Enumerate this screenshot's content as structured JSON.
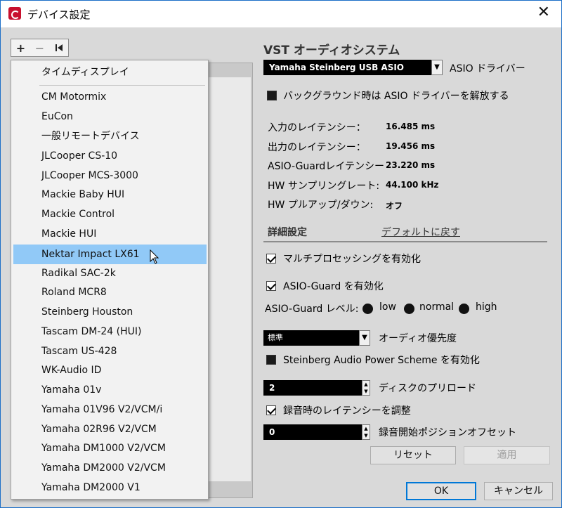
{
  "window": {
    "title": "デバイス設定",
    "close_glyph": "✕"
  },
  "toolbar": {
    "add_glyph": "+",
    "remove_glyph": "−",
    "reset_glyph": "⏮"
  },
  "menu": {
    "header": "タイムディスプレイ",
    "items": [
      "CM Motormix",
      "EuCon",
      "一般リモートデバイス",
      "JLCooper CS-10",
      "JLCooper MCS-3000",
      "Mackie Baby HUI",
      "Mackie Control",
      "Mackie HUI",
      "Nektar Impact LX61",
      "Radikal SAC-2k",
      "Roland MCR8",
      "Steinberg Houston",
      "Tascam DM-24 (HUI)",
      "Tascam US-428",
      "WK-Audio ID",
      "Yamaha 01v",
      "Yamaha 01V96 V2/VCM/i",
      "Yamaha 02R96 V2/VCM",
      "Yamaha DM1000 V2/VCM",
      "Yamaha DM2000 V2/VCM",
      "Yamaha DM2000 V1"
    ],
    "highlighted_index": 8
  },
  "vst": {
    "title": "VST オーディオシステム",
    "driver_value": "Yamaha Steinberg USB ASIO",
    "driver_label": "ASIO ドライバー",
    "release_driver_label": "バックグラウンド時は ASIO ドライバーを解放する",
    "release_driver_checked": false,
    "info": [
      {
        "label": "入力のレイテンシー：",
        "value": "16.485 ms"
      },
      {
        "label": "出力のレイテンシー：",
        "value": "19.456 ms"
      },
      {
        "label": "ASIO-Guardレイテンシー",
        "value": "23.220 ms"
      },
      {
        "label": "HW サンプリングレート:",
        "value": "44.100 kHz"
      },
      {
        "label": "HW プルアップ/ダウン:",
        "value": "オフ"
      }
    ],
    "advanced_title": "詳細設定",
    "reset_defaults": "デフォルトに戻す",
    "multiprocessing_label": "マルチプロセッシングを有効化",
    "multiprocessing_checked": true,
    "asio_guard_label": "ASIO-Guard を有効化",
    "asio_guard_checked": true,
    "asio_guard_level_label": "ASIO-Guard レベル:",
    "level_low": "low",
    "level_normal": "normal",
    "level_high": "high",
    "audio_priority_value": "標準",
    "audio_priority_label": "オーディオ優先度",
    "power_scheme_label": "Steinberg Audio Power Scheme を有効化",
    "power_scheme_checked": false,
    "disk_preload_value": "2",
    "disk_preload_label": "ディスクのプリロード",
    "adjust_latency_label": "録音時のレイテンシーを調整",
    "adjust_latency_checked": true,
    "record_shift_value": "0",
    "record_shift_label": "録音開始ポジションオフセット",
    "reset_button": "リセット",
    "apply_button": "適用"
  },
  "footer": {
    "ok": "OK",
    "cancel": "キャンセル"
  }
}
